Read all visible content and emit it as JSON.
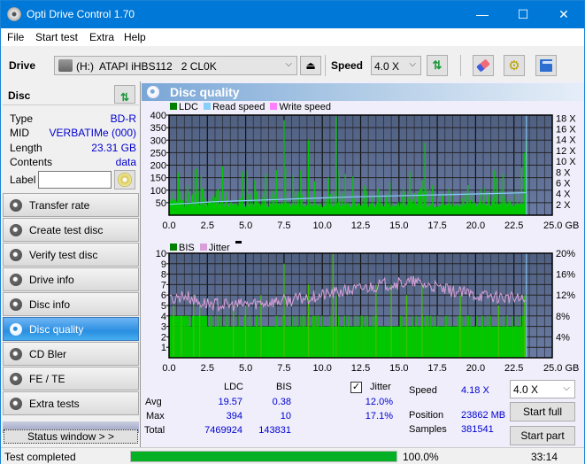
{
  "window": {
    "title": "Opti Drive Control 1.70",
    "minimize": "—",
    "maximize": "☐",
    "close": "✕"
  },
  "menu": [
    "File",
    "Start test",
    "Extra",
    "Help"
  ],
  "toolbar": {
    "drive_label": "Drive",
    "drive_value": "(H:)  ATAPI iHBS112   2 CL0K",
    "speed_label": "Speed",
    "speed_value": "4.0 X"
  },
  "disc": {
    "header": "Disc",
    "props": [
      {
        "key": "Type",
        "value": "BD-R"
      },
      {
        "key": "MID",
        "value": "VERBATIMe (000)"
      },
      {
        "key": "Length",
        "value": "23.31 GB"
      },
      {
        "key": "Contents",
        "value": "data"
      }
    ],
    "label_key": "Label",
    "label_value": ""
  },
  "nav": [
    {
      "label": "Transfer rate",
      "active": false
    },
    {
      "label": "Create test disc",
      "active": false
    },
    {
      "label": "Verify test disc",
      "active": false
    },
    {
      "label": "Drive info",
      "active": false
    },
    {
      "label": "Disc info",
      "active": false
    },
    {
      "label": "Disc quality",
      "active": true
    },
    {
      "label": "CD Bler",
      "active": false
    },
    {
      "label": "FE / TE",
      "active": false
    },
    {
      "label": "Extra tests",
      "active": false
    }
  ],
  "status_window_button": "Status window > >",
  "panel_title": "Disc quality",
  "chart_data": [
    {
      "type": "bar",
      "title": "LDC / Read speed",
      "legend": [
        {
          "name": "LDC",
          "color": "#008000"
        },
        {
          "name": "Read speed",
          "color": "#87cefa"
        },
        {
          "name": "Write speed",
          "color": "#ff80ff"
        }
      ],
      "x_ticks": [
        "0.0",
        "2.5",
        "5.0",
        "7.5",
        "10.0",
        "12.5",
        "15.0",
        "17.5",
        "20.0",
        "22.5",
        "25.0 GB"
      ],
      "xlim": [
        0,
        25
      ],
      "y_ticks": [
        "400",
        "350",
        "300",
        "250",
        "200",
        "150",
        "100",
        "50"
      ],
      "ylim": [
        0,
        400
      ],
      "y2_ticks": [
        "18 X",
        "16 X",
        "14 X",
        "12 X",
        "10 X",
        "8 X",
        "6 X",
        "4 X",
        "2 X"
      ],
      "y2lim": [
        0,
        18
      ],
      "data_end_gb": 23.31,
      "ldc_baseline": 30,
      "ldc_spikes": [
        [
          0.6,
          170
        ],
        [
          1.2,
          120
        ],
        [
          1.6,
          180
        ],
        [
          1.8,
          185
        ],
        [
          2.1,
          160
        ],
        [
          3.2,
          105
        ],
        [
          3.5,
          195
        ],
        [
          4.8,
          175
        ],
        [
          5.1,
          180
        ],
        [
          5.6,
          140
        ],
        [
          6.3,
          165
        ],
        [
          7.0,
          180
        ],
        [
          7.5,
          380
        ],
        [
          7.6,
          190
        ],
        [
          8.1,
          160
        ],
        [
          8.6,
          180
        ],
        [
          9.1,
          300
        ],
        [
          9.5,
          135
        ],
        [
          10.4,
          150
        ],
        [
          10.9,
          394
        ],
        [
          11.1,
          180
        ],
        [
          11.5,
          165
        ],
        [
          12.0,
          155
        ],
        [
          12.8,
          120
        ],
        [
          13.6,
          105
        ],
        [
          14.4,
          130
        ],
        [
          15.7,
          175
        ],
        [
          16.5,
          140
        ],
        [
          16.7,
          290
        ],
        [
          17.2,
          120
        ],
        [
          19.5,
          120
        ],
        [
          21.2,
          180
        ],
        [
          21.4,
          150
        ],
        [
          21.8,
          165
        ],
        [
          23.0,
          190
        ],
        [
          23.2,
          250
        ],
        [
          23.3,
          300
        ]
      ],
      "read_speed": [
        [
          0,
          2.0
        ],
        [
          3,
          2.5
        ],
        [
          6,
          2.8
        ],
        [
          9,
          3.1
        ],
        [
          12,
          3.4
        ],
        [
          15,
          3.6
        ],
        [
          18,
          3.8
        ],
        [
          21,
          4.0
        ],
        [
          23.3,
          4.18
        ]
      ]
    },
    {
      "type": "bar",
      "title": "BIS / Jitter",
      "legend": [
        {
          "name": "BIS",
          "color": "#008000"
        },
        {
          "name": "Jitter",
          "color": "#d8a0d8"
        }
      ],
      "x_ticks": [
        "0.0",
        "2.5",
        "5.0",
        "7.5",
        "10.0",
        "12.5",
        "15.0",
        "17.5",
        "20.0",
        "22.5",
        "25.0 GB"
      ],
      "xlim": [
        0,
        25
      ],
      "y_ticks": [
        "10",
        "9",
        "8",
        "7",
        "6",
        "5",
        "4",
        "3",
        "2",
        "1"
      ],
      "ylim": [
        0,
        10
      ],
      "y2_ticks": [
        "20%",
        "16%",
        "12%",
        "8%",
        "4%"
      ],
      "y2lim": [
        0,
        20
      ],
      "data_end_gb": 23.31,
      "bis_baseline": 3,
      "bis_spikes": [
        [
          0.3,
          5
        ],
        [
          0.8,
          4
        ],
        [
          1.6,
          6
        ],
        [
          2.0,
          5
        ],
        [
          4.2,
          5
        ],
        [
          5.0,
          5
        ],
        [
          6.0,
          6
        ],
        [
          7.5,
          9
        ],
        [
          9.1,
          7
        ],
        [
          10.7,
          10
        ],
        [
          10.9,
          6
        ],
        [
          13.5,
          7
        ],
        [
          14.5,
          7
        ],
        [
          15.5,
          6
        ],
        [
          16.5,
          7
        ],
        [
          19.0,
          6
        ],
        [
          21.5,
          5
        ],
        [
          23.2,
          6
        ]
      ],
      "jitter": [
        [
          0,
          11
        ],
        [
          1,
          12
        ],
        [
          2,
          10.5
        ],
        [
          4,
          10
        ],
        [
          6,
          10.5
        ],
        [
          8,
          11
        ],
        [
          10,
          12
        ],
        [
          12,
          13
        ],
        [
          14,
          14
        ],
        [
          16,
          14.5
        ],
        [
          18,
          13
        ],
        [
          20,
          12
        ],
        [
          22,
          11.5
        ],
        [
          23.3,
          11
        ]
      ]
    }
  ],
  "stats": {
    "columns": [
      "LDC",
      "BIS"
    ],
    "rows": [
      {
        "label": "Avg",
        "ldc": "19.57",
        "bis": "0.38",
        "jitter": "12.0%"
      },
      {
        "label": "Max",
        "ldc": "394",
        "bis": "10",
        "jitter": "17.1%"
      },
      {
        "label": "Total",
        "ldc": "7469924",
        "bis": "143831"
      }
    ],
    "jitter_label": "Jitter",
    "jitter_checked": true,
    "speed_label": "Speed",
    "speed_value": "4.18 X",
    "position_label": "Position",
    "position_value": "23862 MB",
    "samples_label": "Samples",
    "samples_value": "381541",
    "speed_select": "4.0 X",
    "start_full": "Start full",
    "start_part": "Start part"
  },
  "statusbar": {
    "text": "Test completed",
    "progress": 100.0,
    "progress_text": "100.0%",
    "time": "33:14"
  }
}
